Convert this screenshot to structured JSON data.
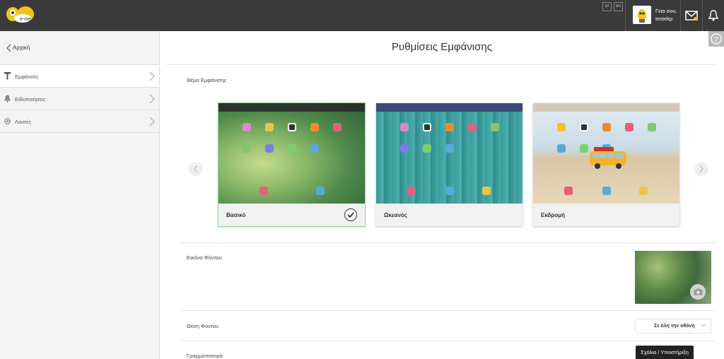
{
  "header": {
    "logo_text": "e-me",
    "languages": [
      "el",
      "en"
    ],
    "user": {
      "greeting": "Γεια σου,",
      "username": "testekp"
    },
    "icons": [
      "mail-icon",
      "bell-icon"
    ],
    "accent": "#f0c419"
  },
  "sidebar": {
    "back_label": "Αρχική",
    "items": [
      {
        "label": "Εμφάνιση",
        "icon": "brush-icon",
        "active": true
      },
      {
        "label": "Ειδοποιήσεις",
        "icon": "bell-icon",
        "active": false
      },
      {
        "label": "Λοιπές",
        "icon": "gear-icon",
        "active": false
      }
    ]
  },
  "main": {
    "title": "Ρυθμίσεις Εμφάνισης",
    "theme_label": "Θέμα Εμφάνισης",
    "themes": [
      {
        "name": "Βασικό",
        "selected": true
      },
      {
        "name": "Ωκεανός",
        "selected": false
      },
      {
        "name": "Εκδρομή",
        "selected": false
      }
    ],
    "background_image_label": "Εικόνα Φόντου",
    "background_position_label": "Θέση Φόντου",
    "background_position_value": "Σε όλη την οθόνη",
    "font_label": "Γραμματοσειρά"
  },
  "feedback_button": "Σχόλια / Υποστήριξη"
}
